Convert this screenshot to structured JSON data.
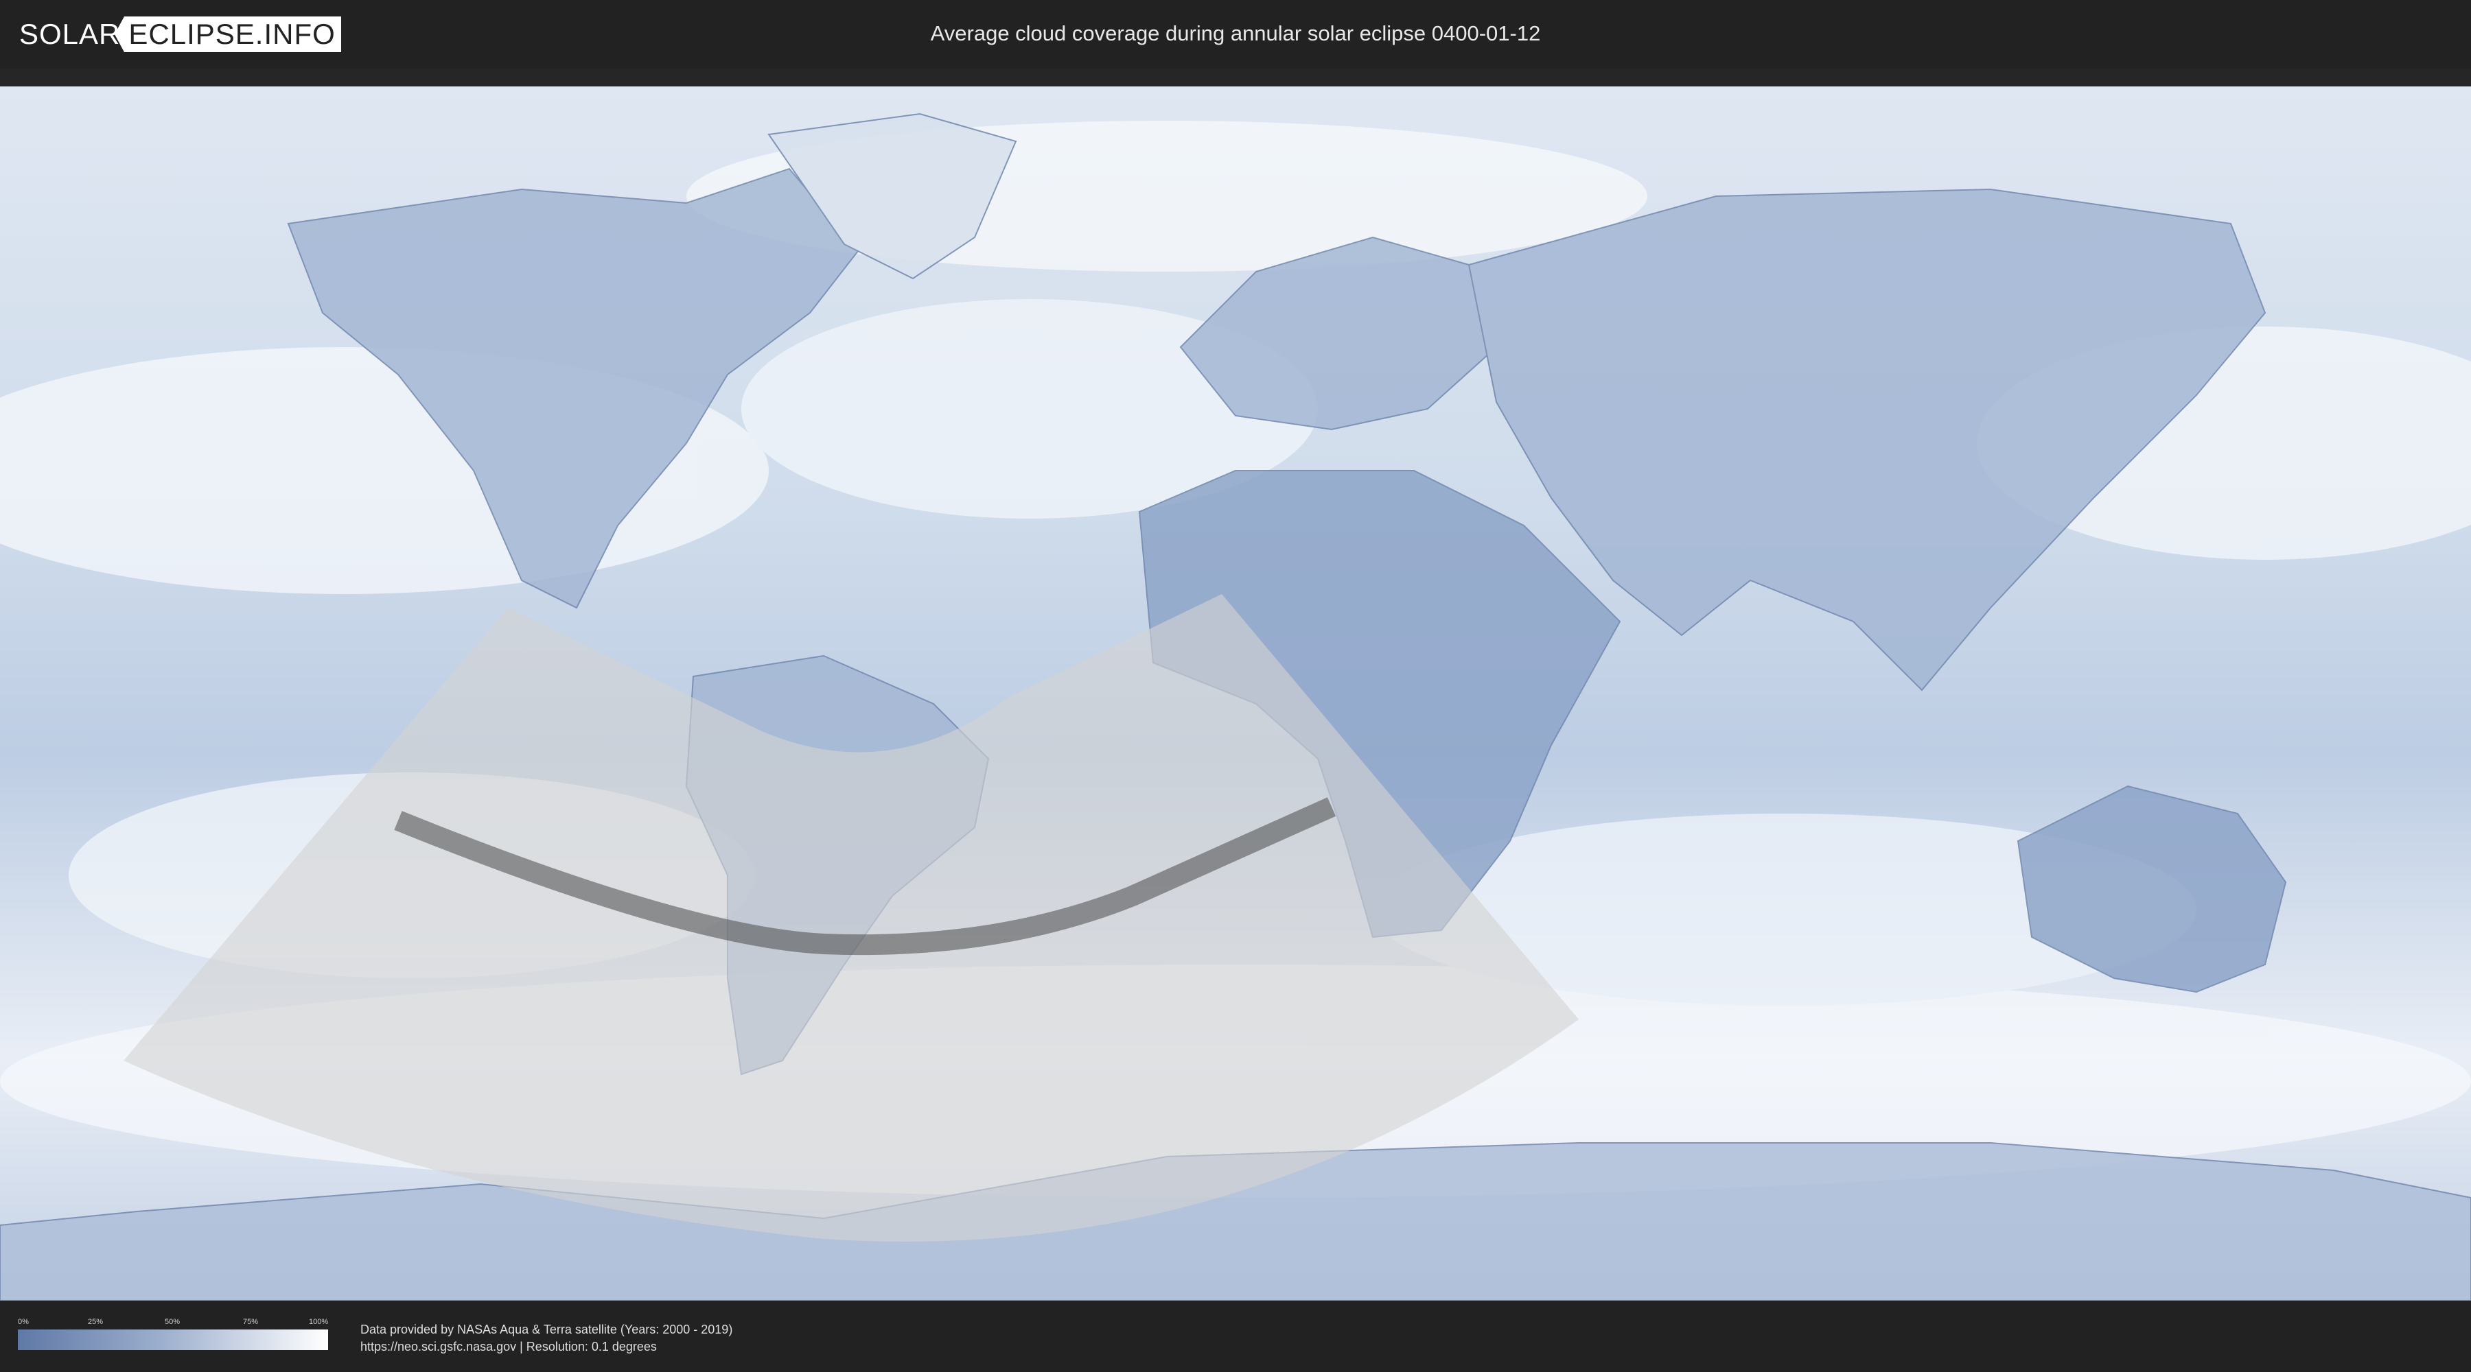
{
  "header": {
    "logo_left": "SOLAR",
    "logo_right": "ECLIPSE.INFO",
    "title": "Average cloud coverage during annular solar eclipse 0400-01-12"
  },
  "legend": {
    "ticks": [
      "0%",
      "25%",
      "50%",
      "75%",
      "100%"
    ],
    "color_low": "#5f79a6",
    "color_high": "#ffffff"
  },
  "credits": {
    "line1": "Data provided by NASAs Aqua & Terra satellite (Years: 2000 - 2019)",
    "line2": "https://neo.sci.gsfc.nasa.gov | Resolution: 0.1 degrees"
  },
  "map": {
    "ocean_color": "#c9d6e8",
    "cloud_color": "#f4f7fb",
    "land_color": "#7f98c2",
    "shadow_color": "#d4d4d4",
    "central_path_color": "#4a4a4a"
  }
}
